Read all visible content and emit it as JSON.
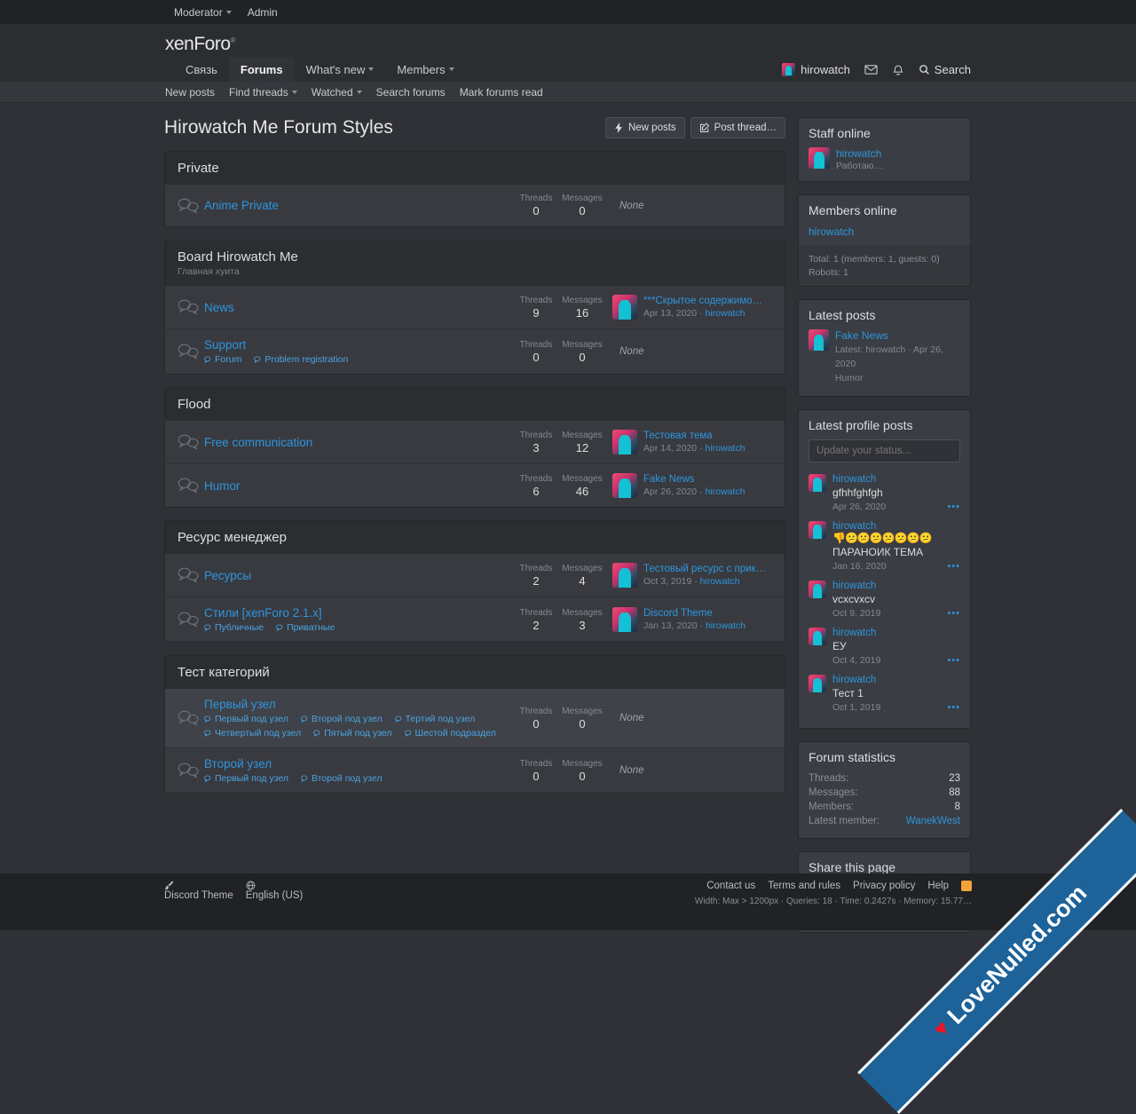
{
  "topbar": {
    "moderator": "Moderator",
    "admin": "Admin"
  },
  "brand": {
    "logo": "xenForo",
    "sup": "®"
  },
  "nav": {
    "items": [
      {
        "label": "Связь",
        "active": false,
        "caret": false
      },
      {
        "label": "Forums",
        "active": true,
        "caret": false
      },
      {
        "label": "What's new",
        "active": false,
        "caret": true
      },
      {
        "label": "Members",
        "active": false,
        "caret": true
      }
    ],
    "username": "hirowatch",
    "search_label": "Search"
  },
  "subnav": {
    "items": [
      {
        "label": "New posts",
        "caret": false
      },
      {
        "label": "Find threads",
        "caret": true
      },
      {
        "label": "Watched",
        "caret": true
      },
      {
        "label": "Search forums",
        "caret": false
      },
      {
        "label": "Mark forums read",
        "caret": false
      }
    ]
  },
  "page_title": "Hirowatch Me Forum Styles",
  "buttons": {
    "new_posts": "New posts",
    "post_thread": "Post thread…"
  },
  "labels": {
    "threads": "Threads",
    "messages": "Messages",
    "none": "None"
  },
  "categories": [
    {
      "title": "Private",
      "desc": "",
      "nodes": [
        {
          "name": "Anime Private",
          "subs": [],
          "threads": "0",
          "messages": "0",
          "last": null,
          "highlight": false
        }
      ]
    },
    {
      "title": "Board Hirowatch Me",
      "desc": "Главная хуита",
      "nodes": [
        {
          "name": "News",
          "subs": [],
          "threads": "9",
          "messages": "16",
          "last": {
            "title": "***Скрытое содержимое***",
            "date": "Apr 13, 2020",
            "user": "hirowatch"
          },
          "highlight": false
        },
        {
          "name": "Support",
          "subs": [
            "Forum",
            "Problem registration"
          ],
          "threads": "0",
          "messages": "0",
          "last": null,
          "highlight": false
        }
      ]
    },
    {
      "title": "Flood",
      "desc": "",
      "nodes": [
        {
          "name": "Free communication",
          "subs": [],
          "threads": "3",
          "messages": "12",
          "last": {
            "title": "Тестовая тема",
            "date": "Apr 14, 2020",
            "user": "hirowatch"
          },
          "highlight": false
        },
        {
          "name": "Humor",
          "subs": [],
          "threads": "6",
          "messages": "46",
          "last": {
            "title": "Fake News",
            "date": "Apr 26, 2020",
            "user": "hirowatch"
          },
          "highlight": false
        }
      ]
    },
    {
      "title": "Ресурс менеджер",
      "desc": "",
      "nodes": [
        {
          "name": "Ресурсы",
          "subs": [],
          "threads": "2",
          "messages": "4",
          "last": {
            "title": "Тестовый ресурс с прикрепленны…",
            "date": "Oct 3, 2019",
            "user": "hirowatch"
          },
          "highlight": false
        },
        {
          "name": "Стили [xenForo 2.1.x]",
          "subs": [
            "Публичные",
            "Приватные"
          ],
          "threads": "2",
          "messages": "3",
          "last": {
            "title": "Discord Theme",
            "date": "Jan 13, 2020",
            "user": "hirowatch"
          },
          "highlight": false
        }
      ]
    },
    {
      "title": "Тест категорий",
      "desc": "",
      "nodes": [
        {
          "name": "Первый узел",
          "subs": [
            "Первый под узел",
            "Второй под узел",
            "Тертий под узел",
            "Четвертый под узел",
            "Пятый под узел",
            "Шестой подраздел"
          ],
          "threads": "0",
          "messages": "0",
          "last": null,
          "highlight": true
        },
        {
          "name": "Второй узел",
          "subs": [
            "Первый под узел",
            "Второй под узел"
          ],
          "threads": "0",
          "messages": "0",
          "last": null,
          "highlight": false
        }
      ]
    }
  ],
  "sidebar": {
    "staff_online": {
      "title": "Staff online",
      "user": "hirowatch",
      "status": "Работаю…"
    },
    "members_online": {
      "title": "Members online",
      "user": "hirowatch",
      "total": "Total: 1 (members: 1, guests: 0)",
      "robots": "Robots: 1"
    },
    "latest_posts": {
      "title": "Latest posts",
      "thread": "Fake News",
      "meta": "Latest: hirowatch · Apr 26, 2020",
      "forum": "Humor"
    },
    "latest_profile_posts": {
      "title": "Latest profile posts",
      "status_placeholder": "Update your status...",
      "posts": [
        {
          "user": "hirowatch",
          "body": "gfhhfghfgh",
          "date": "Apr 26, 2020",
          "emoji": "",
          "dots": "•••"
        },
        {
          "user": "hirowatch",
          "body": "ПАРАНОИК ТЕМА",
          "date": "Jan 16, 2020",
          "emoji": "👎😕😕😕😕😕😕😕",
          "dots": "•••"
        },
        {
          "user": "hirowatch",
          "body": "vcxcvxcv",
          "date": "Oct 9, 2019",
          "emoji": "",
          "dots": "•••"
        },
        {
          "user": "hirowatch",
          "body": "ЕУ",
          "date": "Oct 4, 2019",
          "emoji": "",
          "dots": "•••"
        },
        {
          "user": "hirowatch",
          "body": "Тест 1",
          "date": "Oct 1, 2019",
          "emoji": "",
          "dots": "•••"
        }
      ]
    },
    "forum_statistics": {
      "title": "Forum statistics",
      "rows": [
        {
          "key": "Threads:",
          "value": "23",
          "link": false
        },
        {
          "key": "Messages:",
          "value": "88",
          "link": false
        },
        {
          "key": "Members:",
          "value": "8",
          "link": false
        },
        {
          "key": "Latest member:",
          "value": "WanekWest",
          "link": true
        }
      ]
    },
    "share": {
      "title": "Share this page",
      "icons": [
        "facebook-icon",
        "twitter-icon",
        "reddit-icon",
        "pinterest-icon",
        "tumblr-icon",
        "whatsapp-icon",
        "email-icon",
        "link-icon"
      ]
    }
  },
  "footer": {
    "theme": "Discord Theme",
    "language": "English (US)",
    "links": [
      "Contact us",
      "Terms and rules",
      "Privacy policy",
      "Help"
    ],
    "debug": "Width: Max > 1200px · Queries: 18 · Time: 0.2427s · Memory: 15.77…"
  },
  "watermark": {
    "text": "LoveNulled.com",
    "heart": "♥"
  }
}
